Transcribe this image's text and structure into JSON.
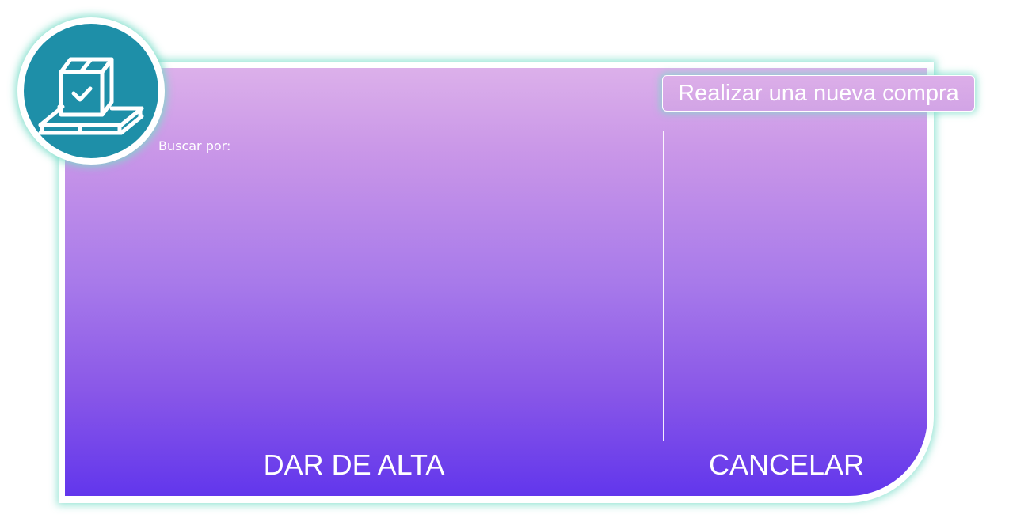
{
  "header": {
    "new_purchase_label": "Realizar una nueva compra"
  },
  "search": {
    "label": "Buscar por:"
  },
  "actions": {
    "add_label": "DAR DE ALTA",
    "cancel_label": "CANCELAR"
  },
  "logo": {
    "icon": "box-on-pallet-check-icon"
  },
  "colors": {
    "gradient_top": "#dcb0ea",
    "gradient_bottom": "#6236ec",
    "logo_teal": "#1e8fa8",
    "glow": "#78dcc8"
  }
}
